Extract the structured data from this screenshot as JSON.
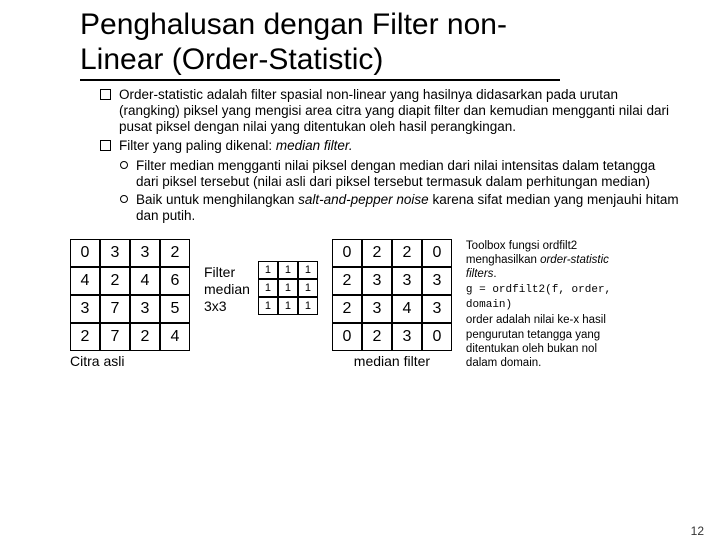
{
  "title_line1": "Penghalusan dengan Filter non-",
  "title_line2": "Linear (Order-Statistic)",
  "bullets": [
    "Order-statistic adalah filter spasial non-linear yang hasilnya didasarkan pada urutan (rangking) piksel yang mengisi area citra yang diapit filter dan kemudian mengganti nilai dari pusat piksel dengan nilai yang ditentukan oleh hasil perangkingan.",
    {
      "prefix": "Filter yang paling dikenal: ",
      "em": "median filter."
    }
  ],
  "sub_bullets": [
    "Filter median mengganti nilai piksel dengan median dari nilai intensitas dalam tetangga dari piksel tersebut (nilai asli dari piksel tersebut termasuk dalam perhitungan median)",
    {
      "prefix": "Baik untuk menghilangkan ",
      "em": "salt-and-pepper noise",
      "suffix": " karena sifat median yang menjauhi hitam dan putih."
    }
  ],
  "grid_left": [
    0,
    3,
    3,
    2,
    4,
    2,
    4,
    6,
    3,
    7,
    3,
    5,
    2,
    7,
    2,
    4
  ],
  "grid_left_caption": "Citra asli",
  "filter_label_l1": "Filter",
  "filter_label_l2": "median",
  "filter_label_l3": "3x3",
  "grid_kernel": [
    1,
    1,
    1,
    1,
    1,
    1,
    1,
    1,
    1
  ],
  "grid_right": [
    0,
    2,
    2,
    0,
    2,
    3,
    3,
    3,
    2,
    3,
    4,
    3,
    0,
    2,
    3,
    0
  ],
  "grid_right_caption": "median filter",
  "toolbox": {
    "l1a": "Toolbox fungsi ordfilt2 menghasilkan ",
    "l1b": "order-statistic filters",
    "l1c": ".",
    "code": "g = ordfilt2(f, order, domain)",
    "l2": "order adalah nilai ke-x hasil pengurutan tetangga yang ditentukan oleh bukan nol dalam domain."
  },
  "page_number": "12"
}
